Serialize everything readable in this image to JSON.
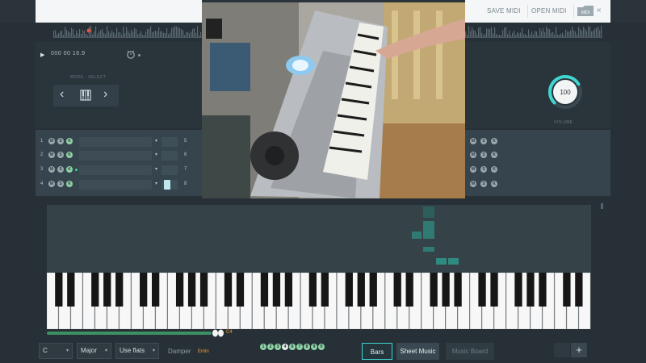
{
  "toolbar": {
    "save_label": "SAVE MIDI",
    "open_label": "OPEN MIDI",
    "midi_badge": "MIDI",
    "collapse": "«"
  },
  "transport": {
    "play": "▶",
    "time": "000 00 16.9"
  },
  "mode_selector": {
    "label": "MODE · SELECT",
    "prev": "‹",
    "next": "›"
  },
  "volume": {
    "value": "100",
    "label": "VOLUME",
    "level_percent": 72
  },
  "tracks": {
    "left": [
      {
        "num": "1",
        "m": "M",
        "s": "S",
        "k": "K",
        "num2": "5",
        "active": false
      },
      {
        "num": "2",
        "m": "M",
        "s": "S",
        "k": "K",
        "num2": "6",
        "active": false
      },
      {
        "num": "3",
        "m": "M",
        "s": "S",
        "k": "K",
        "num2": "7",
        "active": true
      },
      {
        "num": "4",
        "m": "M",
        "s": "S",
        "k": "K",
        "num2": "8",
        "active": false
      }
    ]
  },
  "keyboard": {
    "current_note": "C4",
    "progress_percent": 97
  },
  "bottom": {
    "key": "C",
    "scale": "Major",
    "flats": "Use flats",
    "damper": "Damper",
    "chord": "Emin",
    "fingers": [
      "1",
      "2",
      "3",
      "4",
      "5",
      "6",
      "7",
      "8",
      "9",
      "0"
    ],
    "selected_finger": "4",
    "modes": {
      "bars": "Bars",
      "sheet": "Sheet Music",
      "board": "Music Board"
    },
    "add": "+"
  },
  "colors": {
    "accent": "#3fd6d0",
    "green": "#43d39a",
    "note_bar": "#2f7a72",
    "orange": "#f0a02a"
  }
}
